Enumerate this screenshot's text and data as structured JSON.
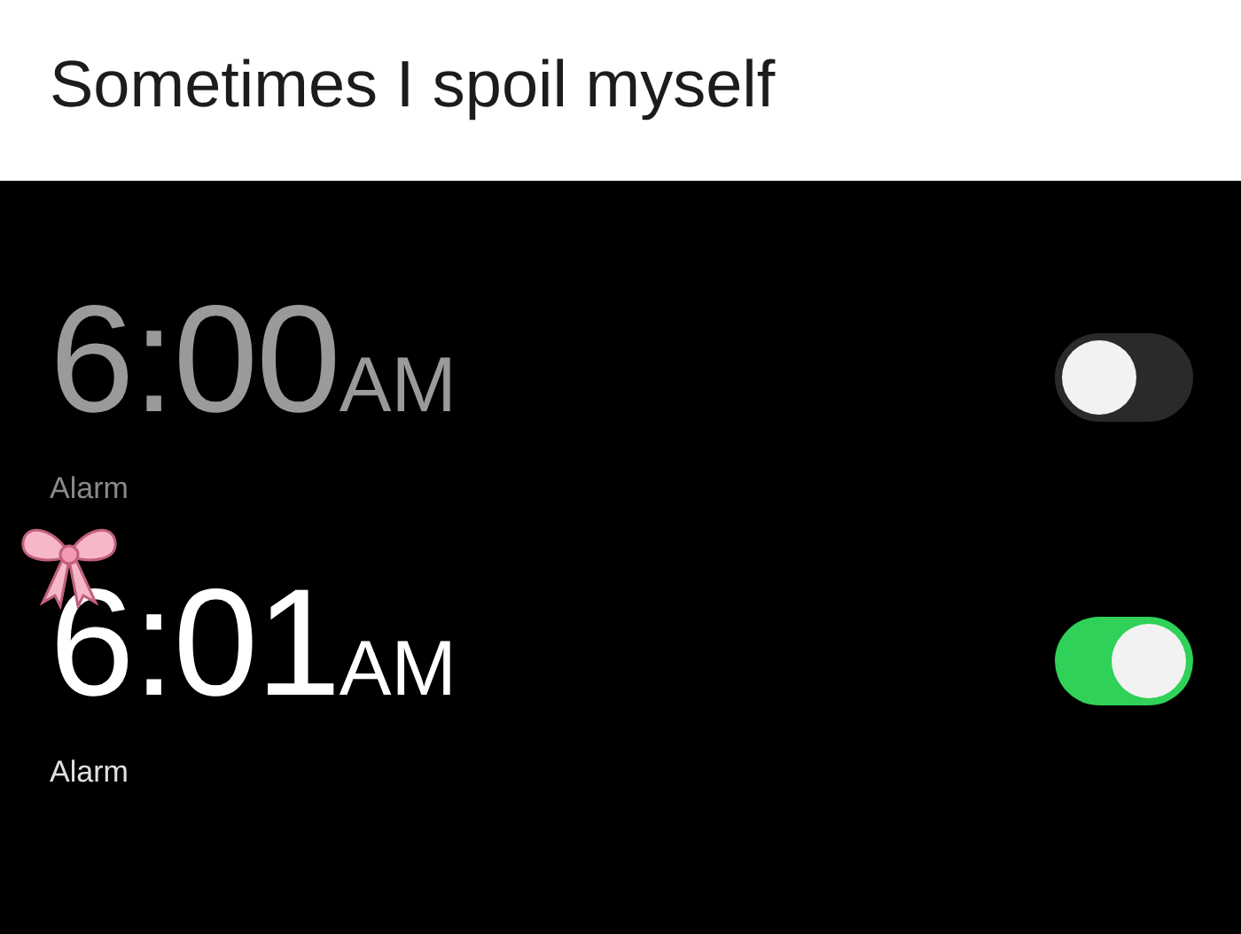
{
  "caption": "Sometimes I spoil myself",
  "alarms": [
    {
      "time": "6:00",
      "period": "AM",
      "label": "Alarm",
      "on": false
    },
    {
      "time": "6:01",
      "period": "AM",
      "label": "Alarm",
      "on": true
    }
  ]
}
